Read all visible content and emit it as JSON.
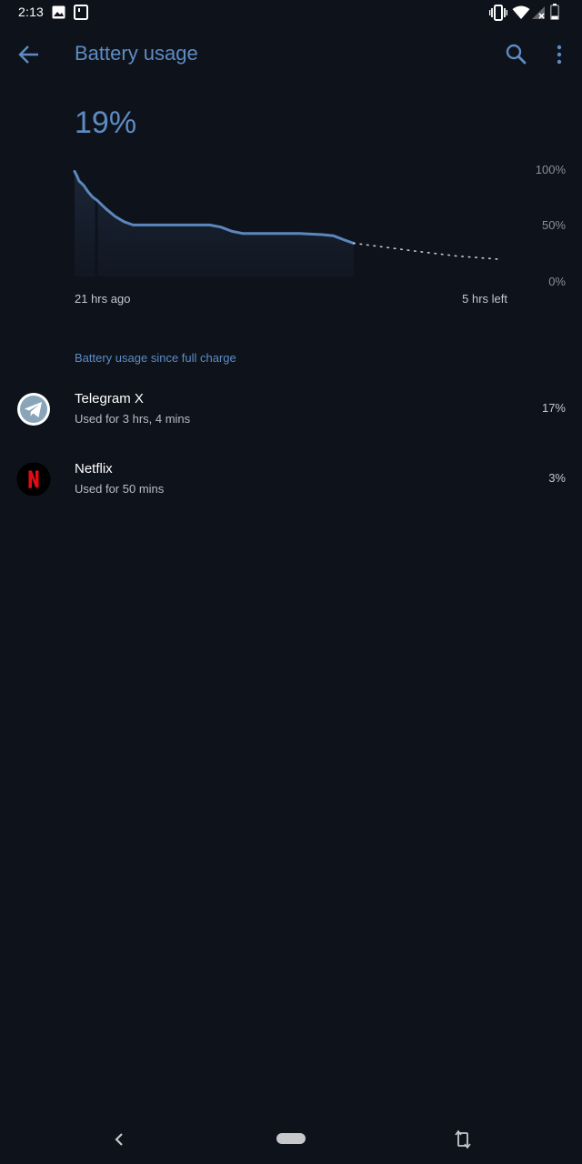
{
  "status_bar": {
    "time": "2:13",
    "icons": [
      "image-icon",
      "screenshot-icon",
      "vibrate-icon",
      "wifi-icon",
      "no-signal-icon",
      "battery-icon"
    ]
  },
  "app_bar": {
    "title": "Battery usage",
    "back_icon": "arrow-back-icon",
    "search_icon": "search-icon",
    "more_icon": "more-vert-icon"
  },
  "battery": {
    "level": "19%"
  },
  "chart_data": {
    "type": "line",
    "y_ticks": [
      "100%",
      "50%",
      "0%"
    ],
    "ylim": [
      0,
      100
    ],
    "x_start_label": "21 hrs ago",
    "x_end_label": "5 hrs left",
    "series": [
      {
        "values": [
          [
            0,
            98
          ],
          [
            0.12,
            93
          ],
          [
            0.2,
            89
          ],
          [
            0.4,
            85
          ],
          [
            0.6,
            79
          ],
          [
            0.8,
            74
          ],
          [
            1.0,
            71
          ],
          [
            1.4,
            63
          ],
          [
            1.8,
            56
          ],
          [
            2.2,
            51
          ],
          [
            2.6,
            48
          ],
          [
            3.0,
            48
          ],
          [
            4.0,
            48
          ],
          [
            5.0,
            48
          ],
          [
            6.0,
            48
          ],
          [
            6.5,
            46
          ],
          [
            7.0,
            42
          ],
          [
            7.5,
            40
          ],
          [
            8.0,
            40
          ],
          [
            9.0,
            40
          ],
          [
            10.0,
            40
          ],
          [
            11.0,
            39
          ],
          [
            11.5,
            38
          ],
          [
            12.0,
            34
          ],
          [
            12.4,
            31
          ]
        ]
      }
    ],
    "projection": [
      [
        12.4,
        31
      ],
      [
        15.0,
        24
      ],
      [
        17.0,
        19
      ],
      [
        18.9,
        16
      ]
    ],
    "x_range": [
      0,
      19
    ],
    "accent": "#5b87bd"
  },
  "section": {
    "header": "Battery usage since full charge"
  },
  "apps": [
    {
      "name": "Telegram X",
      "usage": "Used for 3 hrs, 4 mins",
      "percent": "17%",
      "icon": "telegram-icon",
      "icon_color": "#ffffff"
    },
    {
      "name": "Netflix",
      "usage": "Used for 50 mins",
      "percent": "3%",
      "icon": "netflix-icon",
      "icon_color": "#e50914"
    }
  ],
  "nav_bar": {
    "back_icon": "nav-back-icon",
    "home_icon": "home-pill-icon",
    "rotate_icon": "rotate-icon"
  },
  "colors": {
    "background": "#0e121b",
    "accent": "#5d8cc4",
    "text_primary": "#ffffff",
    "text_secondary": "#b8bcc3"
  }
}
